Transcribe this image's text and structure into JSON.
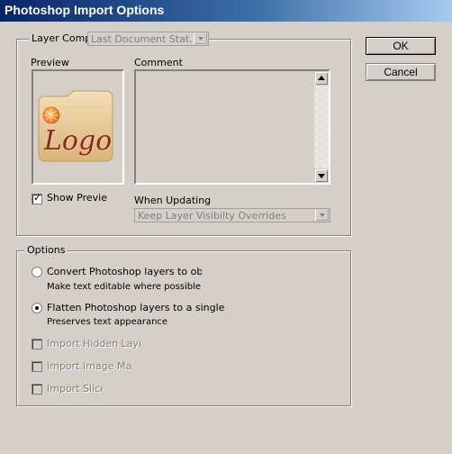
{
  "window": {
    "title": "Photoshop Import Options"
  },
  "buttons": {
    "ok": "OK",
    "cancel": "Cancel"
  },
  "layer_comp": {
    "label": "Layer Comp:",
    "value": "Last Document Stat..."
  },
  "preview": {
    "label": "Preview",
    "logo_text": "Logo",
    "show_preview_label": "Show Previe",
    "show_preview_checked": true
  },
  "comment": {
    "label": "Comment",
    "value": ""
  },
  "when_updating": {
    "label": "When Updating",
    "value": "Keep Layer Visibilty Overrides"
  },
  "options": {
    "label": "Options",
    "convert": {
      "label": "Convert Photoshop layers to obje",
      "sub": "Make text editable where possible",
      "selected": false
    },
    "flatten": {
      "label": "Flatten Photoshop layers to a single im",
      "sub": "Preserves text appearance",
      "selected": true
    },
    "import_hidden": {
      "label": "Import Hidden Laye",
      "checked": false,
      "enabled": false
    },
    "import_image_maps": {
      "label": "Import Image Map",
      "checked": false,
      "enabled": false
    },
    "import_slices": {
      "label": "Import Slice",
      "checked": false,
      "enabled": false
    }
  },
  "colors": {
    "dialog_bg": "#d4d0c8",
    "title_start": "#0a246a",
    "title_end": "#a6caf0"
  }
}
